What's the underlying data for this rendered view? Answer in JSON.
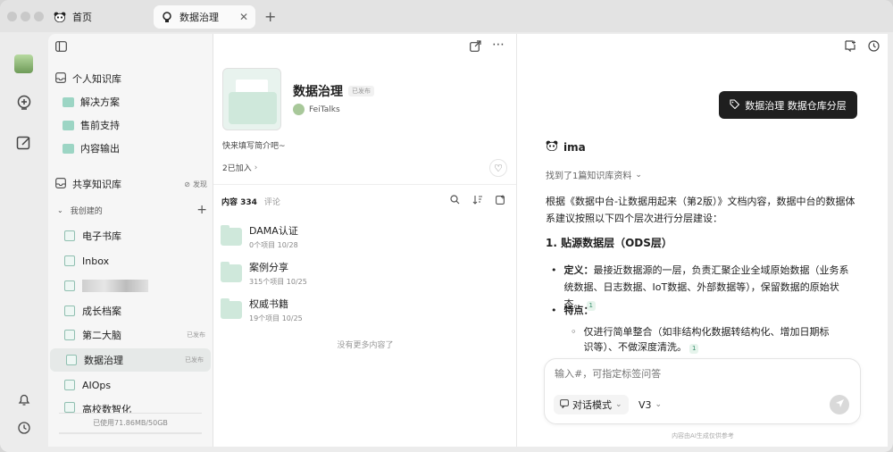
{
  "tabs": [
    {
      "label": "首页"
    },
    {
      "label": "数据治理"
    }
  ],
  "sidebar": {
    "personal_title": "个人知识库",
    "personal_items": [
      {
        "label": "解决方案"
      },
      {
        "label": "售前支持"
      },
      {
        "label": "内容输出"
      }
    ],
    "shared_title": "共享知识库",
    "discover": "发现",
    "created_title": "我创建的",
    "kb_items": [
      {
        "label": "电子书库",
        "badge": ""
      },
      {
        "label": "Inbox",
        "badge": ""
      },
      {
        "label": "",
        "badge": ""
      },
      {
        "label": "成长档案",
        "badge": ""
      },
      {
        "label": "第二大脑",
        "badge": "已发布"
      },
      {
        "label": "数据治理",
        "badge": "已发布"
      },
      {
        "label": "AIOps",
        "badge": ""
      },
      {
        "label": "高校数智化",
        "badge": ""
      }
    ],
    "storage": "已使用71.86MB/50GB"
  },
  "kb": {
    "title": "数据治理",
    "status": "已发布",
    "author": "FeiTalks",
    "intro": "快来填写简介吧~",
    "joined": "2已加入",
    "content_label": "内容 334",
    "comment_label": "评论",
    "folders": [
      {
        "name": "DAMA认证",
        "meta": "0个项目   10/28"
      },
      {
        "name": "案例分享",
        "meta": "315个项目   10/25"
      },
      {
        "name": "权威书籍",
        "meta": "19个项目   10/25"
      }
    ],
    "end_text": "没有更多内容了"
  },
  "chat": {
    "tag_button": "数据治理  数据仓库分层",
    "bot_name": "ima",
    "found": "找到了1篇知识库资料",
    "intro": "根据《数据中台-让数据用起来（第2版）》文档内容，数据中台的数据体系建议按照以下四个层次进行分层建设：",
    "heading": "1. 贴源数据层（ODS层）",
    "def_label": "定义：",
    "def_text": "最接近数据源的一层，负责汇聚企业全域原始数据（业务系统数据、日志数据、IoT数据、外部数据等），保留数据的原始状态。",
    "feat_label": "特点：",
    "feat_text": "仅进行简单整合（如非结构化数据转结构化、增加日期标识等）、不做深度清洗。",
    "cite": "1",
    "input_placeholder": "输入#，可指定标签问答",
    "mode": "对话模式",
    "model": "V3",
    "disclaimer": "内容由AI生成仅供参考"
  }
}
